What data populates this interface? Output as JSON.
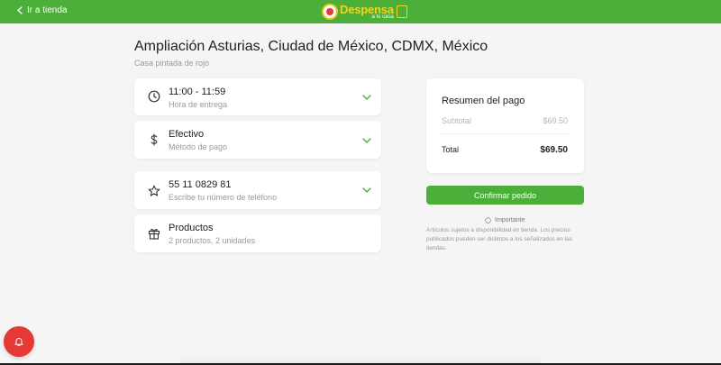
{
  "header": {
    "back_label": "Ir a tienda",
    "logo_main": "Despensa",
    "logo_sub": "a tu casa"
  },
  "address": {
    "title": "Ampliación Asturias, Ciudad de México, CDMX, México",
    "reference": "Casa pintada de rojo"
  },
  "delivery_time": {
    "value": "11:00 - 11:59",
    "label": "Hora de entrega",
    "icon": "clock-icon"
  },
  "payment": {
    "value": "Efectivo",
    "label": "Método de pago",
    "icon": "dollar-icon"
  },
  "phone": {
    "value": "55 11 0829 81",
    "label": "Escribe tu número de teléfono",
    "icon": "star-icon"
  },
  "products": {
    "title": "Productos",
    "detail": "2 productos, 2 unidades",
    "icon": "gift-icon"
  },
  "summary": {
    "title": "Resumen del pago",
    "subtotal_label": "Subtotal",
    "subtotal_value": "$69.50",
    "total_label": "Total",
    "total_value": "$69.50"
  },
  "confirm_label": "Confirmar pedido",
  "notice": {
    "title": "Importante",
    "body": "Artículos sujetos a disponibilidad en tienda. Los precios publicados pueden ser distintos a los señalizados en las tiendas."
  },
  "colors": {
    "brand_green": "#4caf3a",
    "accent_yellow": "#f5d31c",
    "alert_red": "#e53935"
  }
}
